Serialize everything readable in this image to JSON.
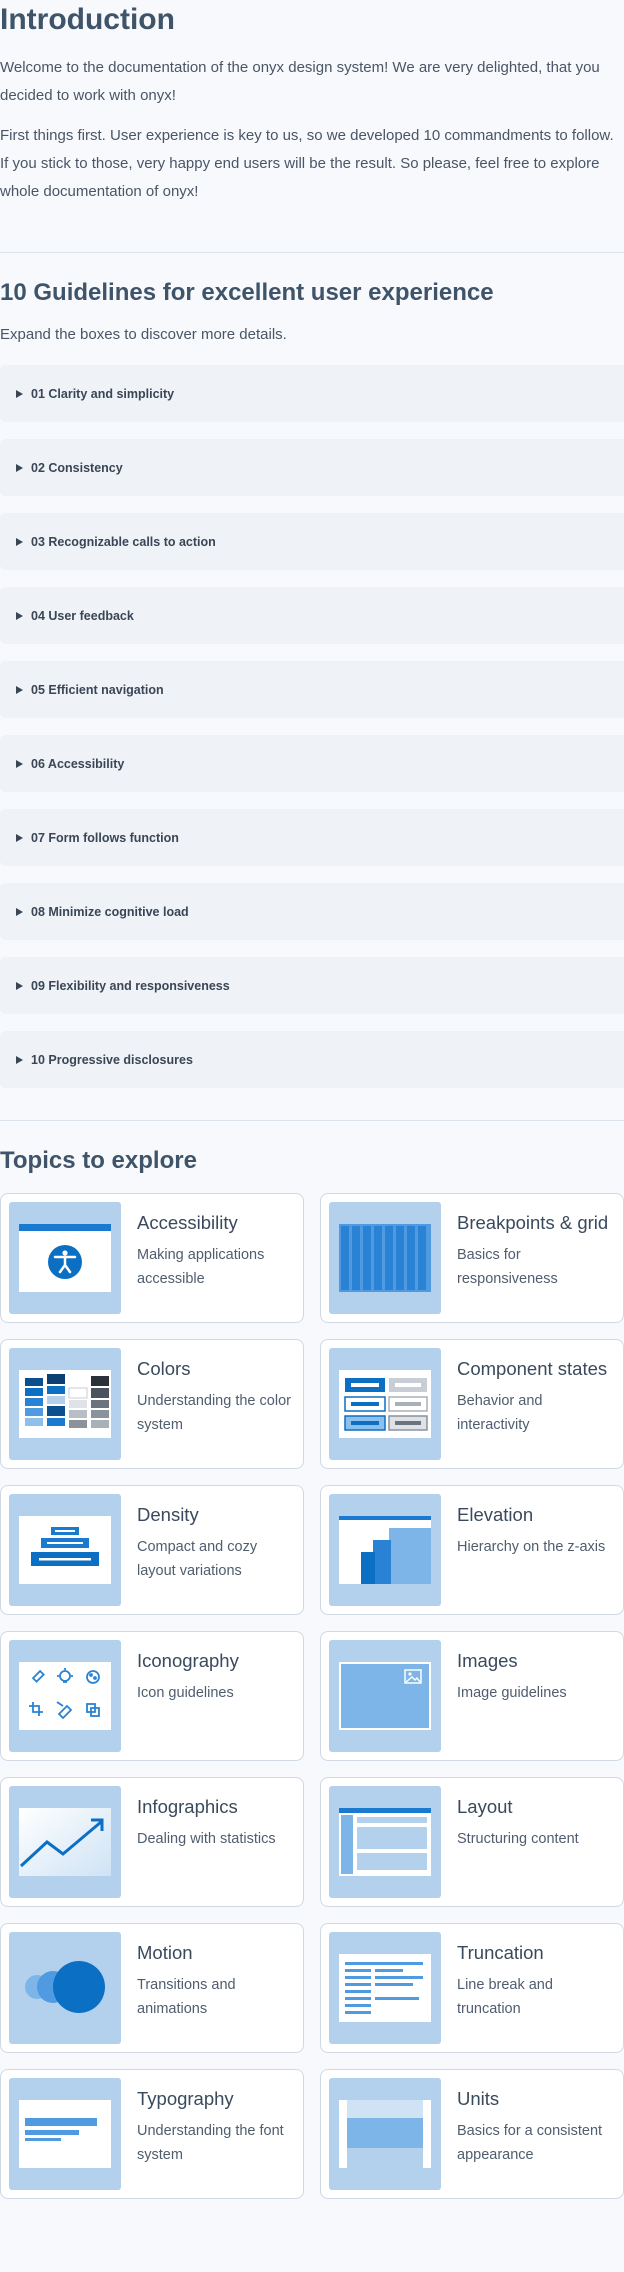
{
  "intro": {
    "title": "Introduction",
    "p1": "Welcome to the documentation of the onyx design system! We are very delighted, that you decided to work with onyx!",
    "p2": "First things first. User experience is key to us, so we developed 10 commandments to follow. If you stick to those, very happy end users will be the result. So please, feel free to explore whole documentation of onyx!"
  },
  "guidelines": {
    "title": "10 Guidelines for excellent user experience",
    "subtitle": "Expand the boxes to discover more details.",
    "items": [
      "01 Clarity and simplicity",
      "02 Consistency",
      "03 Recognizable calls to action",
      "04 User feedback",
      "05 Efficient navigation",
      "06 Accessibility",
      "07 Form follows function",
      "08 Minimize cognitive load",
      "09 Flexibility and responsiveness",
      "10 Progressive disclosures"
    ]
  },
  "topics": {
    "title": "Topics to explore",
    "cards": [
      {
        "title": "Accessibility",
        "desc": "Making applications accessible",
        "icon": "accessibility-illustration"
      },
      {
        "title": "Breakpoints & grid",
        "desc": "Basics for responsiveness",
        "icon": "grid-illustration"
      },
      {
        "title": "Colors",
        "desc": "Understanding the color system",
        "icon": "colors-illustration"
      },
      {
        "title": "Component states",
        "desc": "Behavior and interactivity",
        "icon": "states-illustration"
      },
      {
        "title": "Density",
        "desc": "Compact and cozy layout variations",
        "icon": "density-illustration"
      },
      {
        "title": "Elevation",
        "desc": "Hierarchy on the z-axis",
        "icon": "elevation-illustration"
      },
      {
        "title": "Iconography",
        "desc": "Icon guidelines",
        "icon": "iconography-illustration"
      },
      {
        "title": "Images",
        "desc": "Image guidelines",
        "icon": "images-illustration"
      },
      {
        "title": "Infographics",
        "desc": "Dealing with statistics",
        "icon": "infographics-illustration"
      },
      {
        "title": "Layout",
        "desc": "Structuring content",
        "icon": "layout-illustration"
      },
      {
        "title": "Motion",
        "desc": "Transitions and animations",
        "icon": "motion-illustration"
      },
      {
        "title": "Truncation",
        "desc": "Line break and truncation",
        "icon": "truncation-illustration"
      },
      {
        "title": "Typography",
        "desc": "Understanding the font system",
        "icon": "typography-illustration"
      },
      {
        "title": "Units",
        "desc": "Basics for a consistent appearance",
        "icon": "units-illustration"
      }
    ]
  },
  "colors": {
    "accent": "#0b6fc4",
    "thumb_bg": "#b3d1ec",
    "panel": "#eff2f6"
  }
}
